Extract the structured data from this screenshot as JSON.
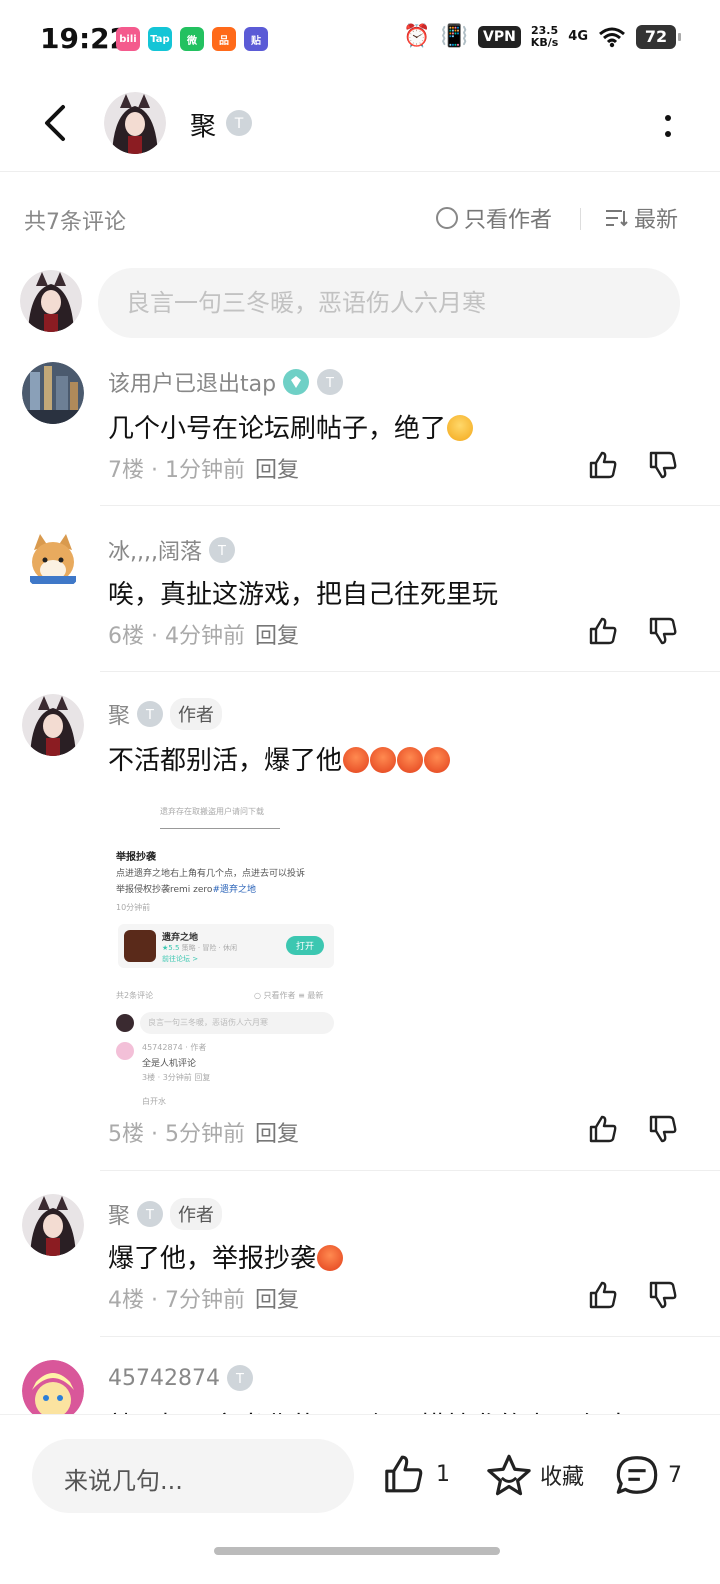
{
  "status_bar": {
    "time": "19:22",
    "vpn": "VPN",
    "speed_value": "23.5",
    "speed_unit": "KB/s",
    "network": "4G",
    "battery": "72",
    "app_icons": [
      {
        "label": "bili",
        "color": "#f45a8d"
      },
      {
        "label": "Tap",
        "color": "#14c5d6"
      },
      {
        "label": "微",
        "color": "#23c160"
      },
      {
        "label": "品",
        "color": "#ff6a1a"
      },
      {
        "label": "贴",
        "color": "#5b5bd6"
      }
    ]
  },
  "header": {
    "title": "聚",
    "badge": "T3"
  },
  "toolbar": {
    "count": "共7条评论",
    "only_author": "只看作者",
    "sort": "最新"
  },
  "composer": {
    "placeholder": "良言一句三冬暖，恶语伤人六月寒"
  },
  "comments": [
    {
      "user": "该用户已退出tap",
      "text": "几个小号在论坛刷帖子，绝了",
      "floor": "7楼",
      "time": "1分钟前",
      "reply": "回复"
    },
    {
      "user": "冰,,,,阔落",
      "text": "唉，真扯这游戏，把自己往死里玩",
      "floor": "6楼",
      "time": "4分钟前",
      "reply": "回复"
    },
    {
      "user": "聚",
      "author_tag": "作者",
      "text": "不活都别活，爆了他",
      "floor": "5楼",
      "time": "5分钟前",
      "reply": "回复"
    },
    {
      "user": "聚",
      "author_tag": "作者",
      "text": "爆了他，举报抄袭",
      "floor": "4楼",
      "time": "7分钟前",
      "reply": "回复"
    },
    {
      "user": "45742874",
      "text": "就是把玩家当韭菜了，但可惜抄袭的事现在才"
    }
  ],
  "embedded": {
    "line1": "遗弃存在取搬盗用户请问下载",
    "title": "举报抄袭",
    "body1": "点进遗弃之地右上角有几个点，点进去可以投诉",
    "body2_prefix": "举报侵权抄袭remi zero",
    "body2_link": "#遗弃之地",
    "time": "10分钟前",
    "game_name": "遗弃之地",
    "game_rating": "★5.5",
    "game_tags": "策略 · 冒险 · 休闲",
    "game_forum": "前往论坛 >",
    "open": "打开",
    "count": "共2条评论",
    "only_author": "只看作者",
    "sort": "最新",
    "placeholder": "良言一句三冬暖，恶语伤人六月寒",
    "c_user": "45742874",
    "c_tag": "作者",
    "c_text": "全是人机评论",
    "c_meta": "3楼 · 3分钟前  回复",
    "c2_user": "白开水"
  },
  "bottom_bar": {
    "input": "来说几句...",
    "likes": "1",
    "favorite": "收藏",
    "comments": "7"
  }
}
